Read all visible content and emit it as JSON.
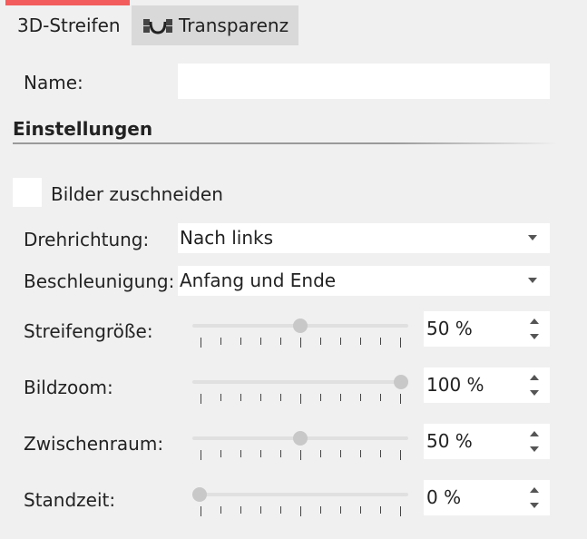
{
  "tabs": [
    {
      "label": "3D-Streifen",
      "active": true
    },
    {
      "label": "Transparenz",
      "active": false,
      "icon": "transparency-wave-icon"
    }
  ],
  "accent_color": "#f25c5c",
  "name_field": {
    "label": "Name:",
    "value": ""
  },
  "section": {
    "title": "Einstellungen"
  },
  "crop_checkbox": {
    "label": "Bilder zuschneiden",
    "checked": false
  },
  "dropdowns": {
    "direction": {
      "label": "Drehrichtung:",
      "value": "Nach links"
    },
    "acceleration": {
      "label": "Beschleunigung:",
      "value": "Anfang und Ende"
    }
  },
  "sliders": {
    "stripe_size": {
      "label": "Streifengröße:",
      "value": 50,
      "display": "50 %"
    },
    "image_zoom": {
      "label": "Bildzoom:",
      "value": 100,
      "display": "100 %"
    },
    "gap": {
      "label": "Zwischenraum:",
      "value": 50,
      "display": "50 %"
    },
    "hold_time": {
      "label": "Standzeit:",
      "value": 0,
      "display": "0 %"
    }
  }
}
